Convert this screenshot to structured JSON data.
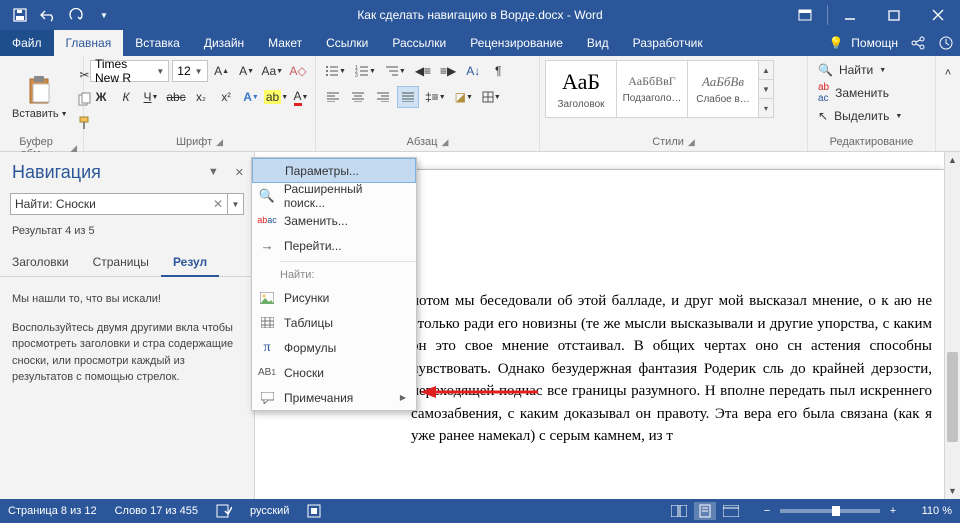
{
  "titlebar": {
    "title": "Как сделать навигацию в Ворде.docx - Word"
  },
  "tabs": {
    "file": "Файл",
    "home": "Главная",
    "insert": "Вставка",
    "design": "Дизайн",
    "layout": "Макет",
    "references": "Ссылки",
    "mailings": "Рассылки",
    "review": "Рецензирование",
    "view": "Вид",
    "developer": "Разработчик",
    "help": "Помощн"
  },
  "ribbon": {
    "clipboard": {
      "label": "Буфер обм…",
      "paste": "Вставить"
    },
    "font": {
      "label": "Шрифт",
      "family": "Times New R",
      "size": "12",
      "bold": "Ж",
      "italic": "К",
      "underline": "Ч",
      "strike": "abc"
    },
    "paragraph": {
      "label": "Абзац"
    },
    "styles": {
      "label": "Стили",
      "s1": {
        "preview": "АаБ",
        "name": "Заголовок"
      },
      "s2": {
        "preview": "АаБбВвГ",
        "name": "Подзаголо…"
      },
      "s3": {
        "preview": "АаБбВв",
        "name": "Слабое в…"
      }
    },
    "editing": {
      "label": "Редактирование",
      "find": "Найти",
      "replace": "Заменить",
      "select": "Выделить"
    }
  },
  "nav": {
    "title": "Навигация",
    "search_value": "Найти: Сноски",
    "result": "Результат 4 из 5",
    "tabs": {
      "headings": "Заголовки",
      "pages": "Страницы",
      "results": "Резул"
    },
    "found_header": "Мы нашли то, что вы искали!",
    "found_body": "Воспользуйтесь двумя другими вкла чтобы просмотреть заголовки и стра содержащие сноски, или просмотри каждый из результатов с помощью стрелок."
  },
  "menu": {
    "options": "Параметры...",
    "adv_search": "Расширенный поиск...",
    "replace": "Заменить...",
    "goto": "Перейти...",
    "find_header": "Найти:",
    "pictures": "Рисунки",
    "tables": "Таблицы",
    "formulas": "Формулы",
    "footnotes": "Сноски",
    "comments": "Примечания"
  },
  "doc_text": "потом мы беседовали об этой балладе, и друг мой высказал мнение, о к аю не столько ради его новизны (те же мысли высказывали и другие упорства, с каким он это свое мнение отстаивал. В общих чертах оно сн астения способны чувствовать. Однако безудержная фантазия Родерик сль до крайней дерзости, переходящей подчас все границы разумного. Н вполне передать пыл искреннего самозабвения, с каким доказывал он правоту. Эта вера его была связана (как я уже ранее намекал) с серым камнем, из т",
  "status": {
    "page": "Страница 8 из 12",
    "words": "Слово 17 из 455",
    "lang": "русский",
    "zoom": "110 %"
  }
}
